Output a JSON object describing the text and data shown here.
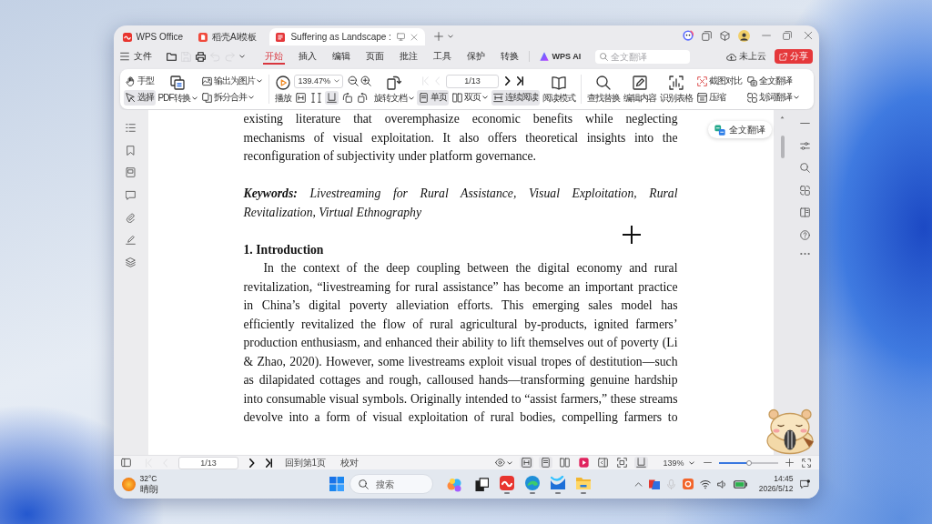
{
  "title_bar": {
    "tabs": [
      {
        "label": "WPS Office",
        "kind": "home",
        "selected": false
      },
      {
        "label": "稻壳AI模板",
        "kind": "templates",
        "selected": false
      },
      {
        "label": "Suffering as Landscape :",
        "kind": "pdf",
        "selected": true
      }
    ]
  },
  "menu_bar": {
    "file_label": "文件",
    "quick_access": [
      {
        "kind": "open",
        "disabled": false
      },
      {
        "kind": "save",
        "disabled": true
      },
      {
        "kind": "print",
        "disabled": false
      },
      {
        "kind": "undo",
        "disabled": true
      },
      {
        "kind": "redo",
        "disabled": true
      }
    ],
    "tabs": [
      {
        "label": "开始",
        "selected": true
      },
      {
        "label": "插入",
        "selected": false
      },
      {
        "label": "编辑",
        "selected": false
      },
      {
        "label": "页面",
        "selected": false
      },
      {
        "label": "批注",
        "selected": false
      },
      {
        "label": "工具",
        "selected": false
      },
      {
        "label": "保护",
        "selected": false
      },
      {
        "label": "转换",
        "selected": false
      }
    ],
    "ai_label": "WPS AI",
    "search": {
      "placeholder": "全文翻译"
    },
    "cloud_label": "未上云",
    "share_label": "分享"
  },
  "ribbon": {
    "pointer_tools": [
      {
        "label": "手型",
        "kind": "hand",
        "selected": false
      },
      {
        "label": "选择",
        "kind": "select",
        "selected": true
      }
    ],
    "pdf_convert": {
      "label": "PDF转换"
    },
    "file_tools": [
      {
        "label": "输出为图片",
        "kind": "image"
      },
      {
        "label": "拆分合并",
        "kind": "split"
      }
    ],
    "play": {
      "label": "播放"
    },
    "zoom": {
      "value": "139.47%"
    },
    "fit_tools": [
      {
        "kind": "fit-width",
        "selected": false
      },
      {
        "kind": "fit-page",
        "selected": false
      },
      {
        "kind": "actual-size",
        "selected": true
      },
      {
        "kind": "rotate-left",
        "selected": false
      },
      {
        "kind": "rotate-right",
        "selected": false
      }
    ],
    "rotate": {
      "label": "旋转文档"
    },
    "page_nav": {
      "buttons": [
        {
          "kind": "first",
          "disabled": true
        },
        {
          "kind": "prev",
          "disabled": true
        },
        {
          "kind": "next",
          "disabled": false
        },
        {
          "kind": "last",
          "disabled": false
        }
      ],
      "page": "1/13"
    },
    "layouts": [
      {
        "label": "单页",
        "kind": "single",
        "selected": true,
        "dropdown": false
      },
      {
        "label": "双页",
        "kind": "double",
        "selected": false,
        "dropdown": true
      },
      {
        "label": "连续阅读",
        "kind": "continuous",
        "selected": true,
        "dropdown": false
      }
    ],
    "read_mode": {
      "label": "阅读模式"
    },
    "tools": [
      {
        "label": "查找替换",
        "kind": "find"
      },
      {
        "label": "编辑内容",
        "kind": "edit"
      },
      {
        "label": "识别表格",
        "kind": "table"
      }
    ],
    "extras": [
      {
        "label": "截图对比",
        "kind": "compare",
        "dropdown": false
      },
      {
        "label": "压缩",
        "kind": "compress",
        "dropdown": false
      },
      {
        "label": "全文翻译",
        "kind": "translate",
        "dropdown": false
      },
      {
        "label": "划词翻译",
        "kind": "word-translate",
        "dropdown": true
      }
    ]
  },
  "document": {
    "paragraphs": [
      {
        "kind": "body",
        "text": "existing literature that overemphasize economic benefits while neglecting\nmechanisms of visual exploitation. It also offers theoretical insights into the\nreconfiguration of subjectivity under platform governance.",
        "first_line_indent": false,
        "continues_below": false
      },
      {
        "kind": "keywords",
        "text": "**Keywords:** Livestreaming for Rural Assistance, Visual Exploitation, Rural\nRevitalization, Virtual Ethnography",
        "first_line_indent": false,
        "continues_below": false
      },
      {
        "kind": "heading",
        "text": "1. Introduction"
      },
      {
        "kind": "body",
        "text": "In the context of the deep coupling between the digital economy and rural\nrevitalization, “livestreaming for rural assistance” has become an important practice\nin China’s digital poverty alleviation efforts. This emerging sales model has\nefficiently revitalized the flow of rural agricultural by-products, ignited farmers’\nproduction enthusiasm, and enhanced their ability to lift themselves out of poverty (Li\n& Zhao, 2020). However, some livestreams exploit visual tropes of destitution—such\nas dilapidated cottages and rough, calloused hands—transforming genuine hardship\ninto consumable visual symbols. Originally intended to “assist farmers,” these streams\ndevolve into a form of visual exploitation of rural bodies, compelling farmers to",
        "first_line_indent": true,
        "continues_below": true
      }
    ],
    "translate_button": {
      "label": "全文翻译"
    }
  },
  "status_bar": {
    "page_nav": {
      "buttons": [
        {
          "kind": "first",
          "disabled": true
        },
        {
          "kind": "prev",
          "disabled": true
        },
        {
          "kind": "next",
          "disabled": false
        },
        {
          "kind": "last",
          "disabled": false
        }
      ],
      "page": "1/13"
    },
    "back_label": "回到第1页",
    "proofread_label": "校对",
    "view_tools": [
      {
        "kind": "eye",
        "selected": false
      },
      {
        "kind": "fit-width",
        "selected": true
      },
      {
        "kind": "single",
        "selected": true
      },
      {
        "kind": "double",
        "selected": false
      },
      {
        "kind": "play",
        "selected": false
      },
      {
        "kind": "sidebar",
        "selected": false
      },
      {
        "kind": "fit-screen",
        "selected": false
      },
      {
        "kind": "actual-size",
        "selected": true
      }
    ],
    "zoom_label": "139%",
    "zoom_slider": {
      "level": 0.52
    }
  },
  "taskbar": {
    "weather": {
      "temperature": "32°C",
      "condition": "晴朗"
    },
    "search": {
      "placeholder": "搜索"
    },
    "apps": [
      {
        "kind": "widgets",
        "running": false
      },
      {
        "kind": "task-view",
        "running": false
      },
      {
        "kind": "wps",
        "running": true
      },
      {
        "kind": "edge",
        "running": true
      },
      {
        "kind": "editor",
        "running": true
      },
      {
        "kind": "explorer",
        "running": true
      }
    ],
    "time": "14:45",
    "date": "2026/5/12"
  }
}
